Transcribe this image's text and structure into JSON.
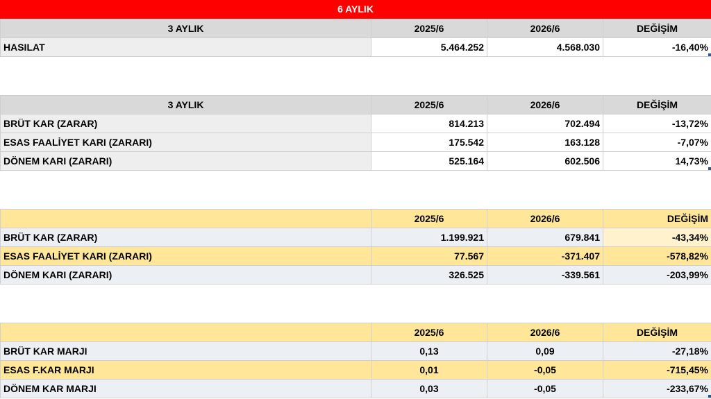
{
  "title": "6 AYLIK",
  "t1": {
    "header": [
      "3 AYLIK",
      "2025/6",
      "2026/6",
      "DEĞİŞİM"
    ],
    "rows": [
      [
        "HASILAT",
        "5.464.252",
        "4.568.030",
        "-16,40%"
      ]
    ]
  },
  "t2": {
    "header": [
      "3 AYLIK",
      "2025/6",
      "2026/6",
      "DEĞİŞİM"
    ],
    "rows": [
      [
        "BRÜT KAR (ZARAR)",
        "814.213",
        "702.494",
        "-13,72%"
      ],
      [
        "ESAS FAALİYET KARI (ZARARI)",
        "175.542",
        "163.128",
        "-7,07%"
      ],
      [
        "DÖNEM KARI (ZARARI)",
        "525.164",
        "602.506",
        "14,73%"
      ]
    ]
  },
  "t3": {
    "header": [
      "",
      "2025/6",
      "2026/6",
      "DEĞİŞİM"
    ],
    "rows": [
      [
        "BRÜT KAR (ZARAR)",
        "1.199.921",
        "679.841",
        "-43,34%"
      ],
      [
        "ESAS FAALİYET KARI (ZARARI)",
        "77.567",
        "-371.407",
        "-578,82%"
      ],
      [
        "DÖNEM KARI (ZARARI)",
        "326.525",
        "-339.561",
        "-203,99%"
      ]
    ]
  },
  "t4": {
    "header": [
      "",
      "2025/6",
      "2026/6",
      "DEĞİŞİM"
    ],
    "rows": [
      [
        "BRÜT KAR MARJI",
        "0,13",
        "0,09",
        "-27,18%"
      ],
      [
        "ESAS F.KAR MARJI",
        "0,01",
        "-0,05",
        "-715,45%"
      ],
      [
        "DÖNEM KAR MARJI",
        "0,03",
        "-0,05",
        "-233,67%"
      ]
    ]
  }
}
